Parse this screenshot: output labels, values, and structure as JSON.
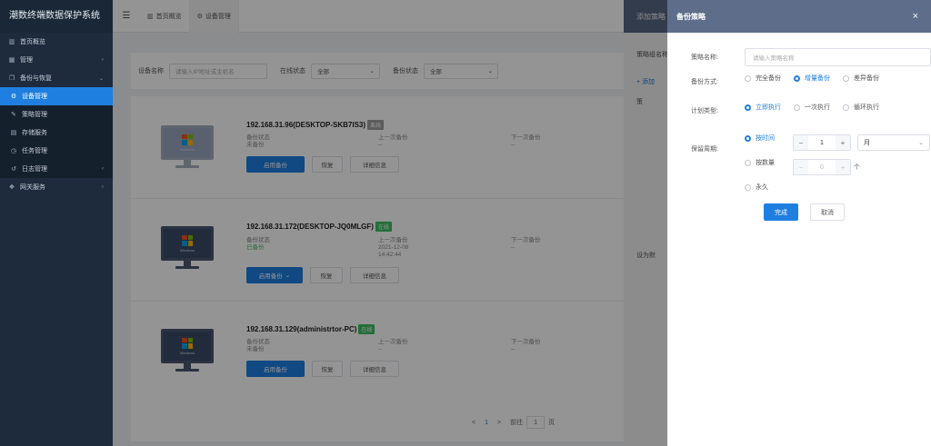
{
  "app": {
    "title": "潮数终端数据保护系统"
  },
  "sidebar": {
    "items": [
      {
        "label": "首页概览",
        "icon": "chart-icon"
      },
      {
        "label": "管理",
        "icon": "grid-icon"
      },
      {
        "label": "备份与恢复",
        "icon": "copy-icon"
      },
      {
        "label": "设备管理",
        "icon": "gears-icon",
        "active": true
      },
      {
        "label": "策略管理",
        "icon": "wrench-icon"
      },
      {
        "label": "存储服务",
        "icon": "storage-icon"
      },
      {
        "label": "任务管理",
        "icon": "clock-icon"
      },
      {
        "label": "日志管理",
        "icon": "history-icon"
      },
      {
        "label": "网关服务",
        "icon": "gateway-icon"
      }
    ]
  },
  "tabs": [
    {
      "label": "首页概览"
    },
    {
      "label": "设备管理"
    }
  ],
  "filter": {
    "device_label": "设备名称",
    "device_placeholder": "请输入IP地址或主机名",
    "online_label": "在线状态",
    "online_value": "全部",
    "backup_label": "备份状态",
    "backup_value": "全部"
  },
  "devices": [
    {
      "name": "192.168.31.96(DESKTOP-SKB7IS3)",
      "status": "离线",
      "backup_state_label": "备份状态",
      "backup_state": "未备份",
      "last_label": "上一次备份",
      "last_value": "--",
      "next_label": "下一次备份",
      "next_value": "--",
      "btn_enable": "启用备份",
      "btn_restore": "恢复",
      "btn_detail": "详细信息"
    },
    {
      "name": "192.168.31.172(DESKTOP-JQ0MLGF)",
      "status": "在线",
      "backup_state_label": "备份状态",
      "backup_state": "已备份",
      "last_label": "上一次备份",
      "last_value": "2021-12-08",
      "last_time": "14:42:44",
      "next_label": "下一次备份",
      "next_value": "--",
      "btn_enable": "启用备份",
      "btn_restore": "恢复",
      "btn_detail": "详细信息"
    },
    {
      "name": "192.168.31.129(administrtor-PC)",
      "status": "在线",
      "backup_state_label": "备份状态",
      "backup_state": "未备份",
      "last_label": "上一次备份",
      "last_value": "--",
      "next_label": "下一次备份",
      "next_value": "--",
      "btn_enable": "启用备份",
      "btn_restore": "恢复",
      "btn_detail": "详细信息"
    }
  ],
  "monitor_text": "Windows",
  "pager": {
    "prev": "<",
    "current": "1",
    "next": ">",
    "goto_label": "前往",
    "goto_value": "1",
    "page_unit": "页"
  },
  "drawer1": {
    "title": "添加策略",
    "name_label": "策略组名称",
    "add_label": "+ 添加",
    "col_label": "策",
    "default_label": "设为默"
  },
  "drawer2": {
    "title": "备份策略",
    "close": "×",
    "name_label": "策略名称:",
    "name_placeholder": "请输入策略名称",
    "mode_label": "备份方式:",
    "mode_options": [
      "完全备份",
      "增量备份",
      "差异备份"
    ],
    "mode_selected": 1,
    "plan_label": "计划类型:",
    "plan_options": [
      "立即执行",
      "一次执行",
      "循环执行"
    ],
    "plan_selected": 0,
    "retain_label": "保留周期:",
    "retain_options": [
      "按时间",
      "按数量",
      "永久"
    ],
    "retain_selected": 0,
    "time_value": "1",
    "time_unit": "月",
    "count_value": "0",
    "count_unit": "个",
    "minus": "−",
    "plus": "+",
    "confirm": "完成",
    "cancel": "取消"
  },
  "colors": {
    "primary": "#1e7fe0",
    "online": "#3cbf62",
    "offline": "#9e9e9e",
    "sidebar": "#1d2b3c",
    "drawer_header": "#5e6e8a"
  }
}
